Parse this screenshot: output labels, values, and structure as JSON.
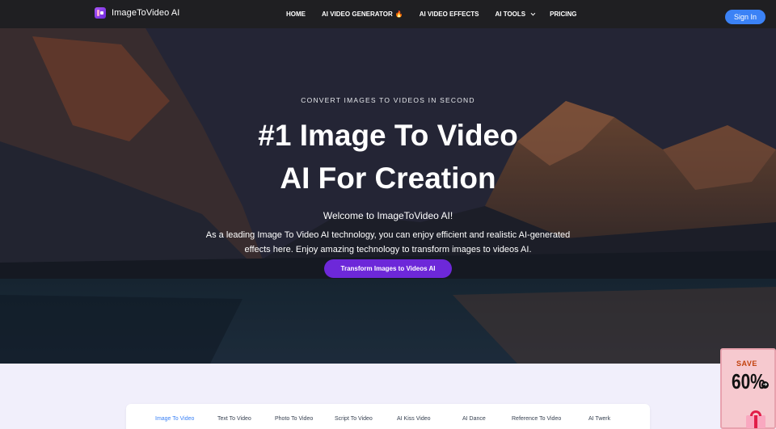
{
  "header": {
    "brand": "ImageToVideo AI",
    "nav": [
      {
        "label": "HOME",
        "has_chevron": false,
        "has_fire": false
      },
      {
        "label": "AI VIDEO GENERATOR",
        "has_chevron": false,
        "has_fire": true
      },
      {
        "label": "AI VIDEO EFFECTS",
        "has_chevron": false,
        "has_fire": false
      },
      {
        "label": "AI TOOLS",
        "has_chevron": true,
        "has_fire": false
      },
      {
        "label": "PRICING",
        "has_chevron": false,
        "has_fire": false
      }
    ],
    "fire_glyph": "🔥",
    "signin_label": "Sign In"
  },
  "hero": {
    "eyebrow": "CONVERT IMAGES TO VIDEOS IN SECOND",
    "title_line1": "#1 Image To Video",
    "title_line2": "AI For Creation",
    "welcome": "Welcome to ImageToVideo AI!",
    "description": "As a leading Image To Video AI technology, you can enjoy efficient and realistic AI-generated effects here. Enjoy amazing technology to transform images to videos AI.",
    "cta_label": "Transform Images to Videos AI"
  },
  "tabs": {
    "items": [
      {
        "label": "Image To Video",
        "active": true
      },
      {
        "label": "Text To Video",
        "active": false
      },
      {
        "label": "Photo To Video",
        "active": false
      },
      {
        "label": "Script To Video",
        "active": false
      },
      {
        "label": "AI Kiss Video",
        "active": false
      },
      {
        "label": "AI Dance",
        "active": false
      },
      {
        "label": "Reference To Video",
        "active": false
      },
      {
        "label": "AI Twerk",
        "active": false
      }
    ]
  },
  "sale_badge": {
    "save_text": "SAVE",
    "percent_text": "60%",
    "arrow_glyph": "➜"
  },
  "colors": {
    "header_bg": "#1f1f22",
    "signin_bg": "#3b82f6",
    "cta_bg": "#6d28d9",
    "active_tab": "#3b82f6",
    "page_bg": "#f1effb"
  }
}
